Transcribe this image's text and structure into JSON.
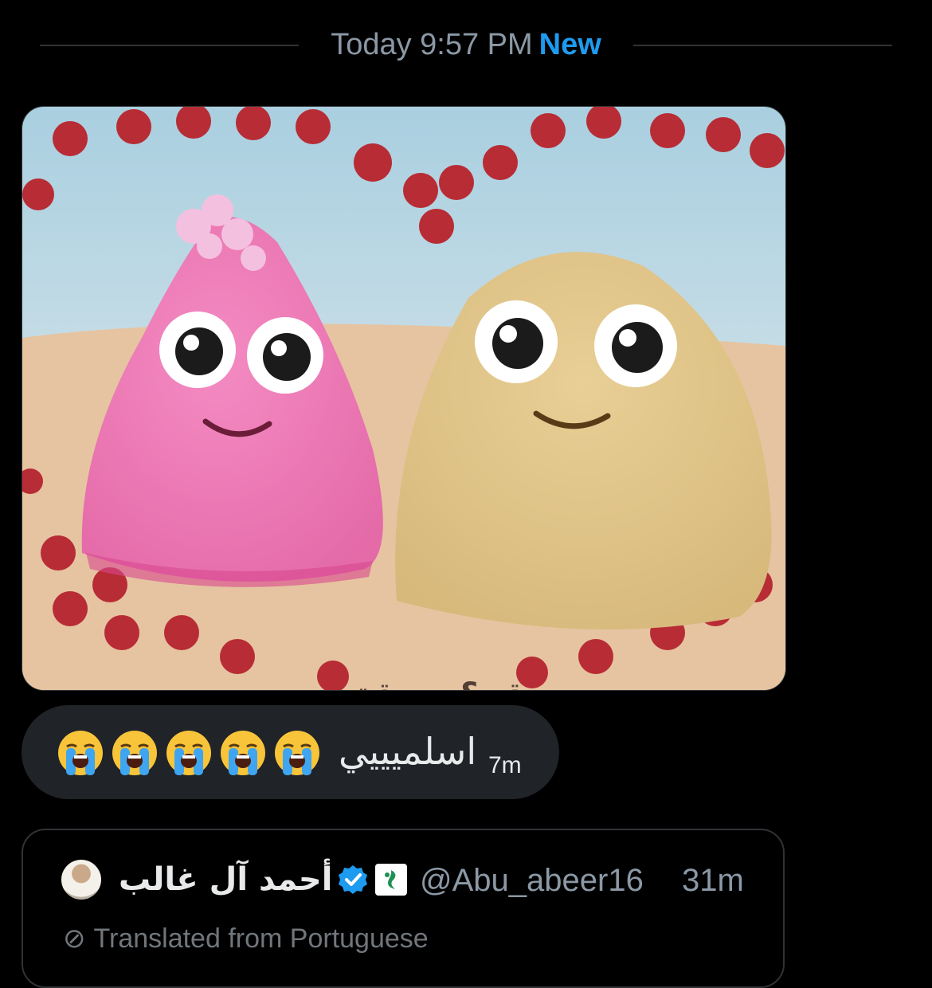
{
  "divider": {
    "time": "Today 9:57 PM",
    "new_label": "New"
  },
  "media": {
    "caption": "زق & زويقة"
  },
  "message": {
    "text": "اسلميييي",
    "emojis": [
      "loudly-crying-face",
      "loudly-crying-face",
      "loudly-crying-face",
      "loudly-crying-face",
      "loudly-crying-face"
    ],
    "time": "7m"
  },
  "quote": {
    "author_name": "أحمد آل غالب",
    "handle": "@Abu_abeer16",
    "time": "31m",
    "translated_label": "Translated from Portuguese"
  },
  "colors": {
    "accent": "#1d9bf0",
    "background": "#000000",
    "bubble": "#202327",
    "muted": "#8b98a5"
  }
}
